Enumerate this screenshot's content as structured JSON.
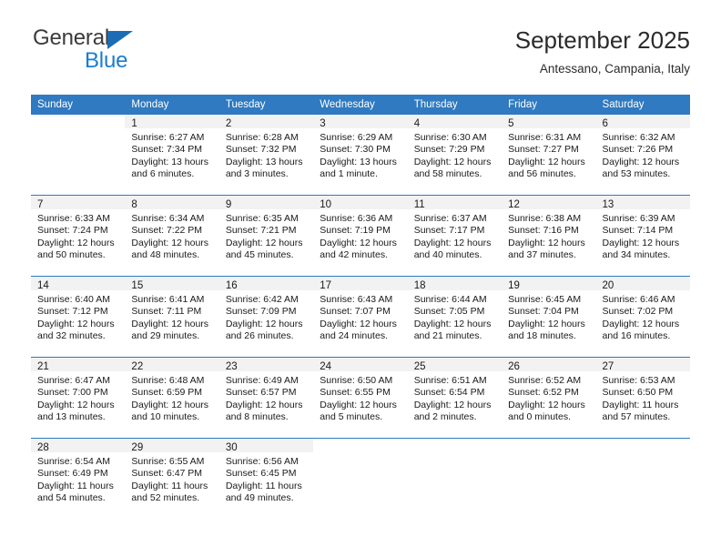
{
  "brand": {
    "name_part1": "General",
    "name_part2": "Blue",
    "triangle_color": "#1b6cb5",
    "blue_color": "#1b7cd1"
  },
  "header": {
    "title": "September 2025",
    "subtitle": "Antessano, Campania, Italy"
  },
  "theme": {
    "header_blue": "#2f7ac0",
    "day_band_gray": "#f2f2f2",
    "text_color": "#1a1a1a"
  },
  "weekday_headers": [
    "Sunday",
    "Monday",
    "Tuesday",
    "Wednesday",
    "Thursday",
    "Friday",
    "Saturday"
  ],
  "weeks": [
    [
      {
        "day": "",
        "sunrise": "",
        "sunset": "",
        "daylight1": "",
        "daylight2": ""
      },
      {
        "day": "1",
        "sunrise": "Sunrise: 6:27 AM",
        "sunset": "Sunset: 7:34 PM",
        "daylight1": "Daylight: 13 hours",
        "daylight2": "and 6 minutes."
      },
      {
        "day": "2",
        "sunrise": "Sunrise: 6:28 AM",
        "sunset": "Sunset: 7:32 PM",
        "daylight1": "Daylight: 13 hours",
        "daylight2": "and 3 minutes."
      },
      {
        "day": "3",
        "sunrise": "Sunrise: 6:29 AM",
        "sunset": "Sunset: 7:30 PM",
        "daylight1": "Daylight: 13 hours",
        "daylight2": "and 1 minute."
      },
      {
        "day": "4",
        "sunrise": "Sunrise: 6:30 AM",
        "sunset": "Sunset: 7:29 PM",
        "daylight1": "Daylight: 12 hours",
        "daylight2": "and 58 minutes."
      },
      {
        "day": "5",
        "sunrise": "Sunrise: 6:31 AM",
        "sunset": "Sunset: 7:27 PM",
        "daylight1": "Daylight: 12 hours",
        "daylight2": "and 56 minutes."
      },
      {
        "day": "6",
        "sunrise": "Sunrise: 6:32 AM",
        "sunset": "Sunset: 7:26 PM",
        "daylight1": "Daylight: 12 hours",
        "daylight2": "and 53 minutes."
      }
    ],
    [
      {
        "day": "7",
        "sunrise": "Sunrise: 6:33 AM",
        "sunset": "Sunset: 7:24 PM",
        "daylight1": "Daylight: 12 hours",
        "daylight2": "and 50 minutes."
      },
      {
        "day": "8",
        "sunrise": "Sunrise: 6:34 AM",
        "sunset": "Sunset: 7:22 PM",
        "daylight1": "Daylight: 12 hours",
        "daylight2": "and 48 minutes."
      },
      {
        "day": "9",
        "sunrise": "Sunrise: 6:35 AM",
        "sunset": "Sunset: 7:21 PM",
        "daylight1": "Daylight: 12 hours",
        "daylight2": "and 45 minutes."
      },
      {
        "day": "10",
        "sunrise": "Sunrise: 6:36 AM",
        "sunset": "Sunset: 7:19 PM",
        "daylight1": "Daylight: 12 hours",
        "daylight2": "and 42 minutes."
      },
      {
        "day": "11",
        "sunrise": "Sunrise: 6:37 AM",
        "sunset": "Sunset: 7:17 PM",
        "daylight1": "Daylight: 12 hours",
        "daylight2": "and 40 minutes."
      },
      {
        "day": "12",
        "sunrise": "Sunrise: 6:38 AM",
        "sunset": "Sunset: 7:16 PM",
        "daylight1": "Daylight: 12 hours",
        "daylight2": "and 37 minutes."
      },
      {
        "day": "13",
        "sunrise": "Sunrise: 6:39 AM",
        "sunset": "Sunset: 7:14 PM",
        "daylight1": "Daylight: 12 hours",
        "daylight2": "and 34 minutes."
      }
    ],
    [
      {
        "day": "14",
        "sunrise": "Sunrise: 6:40 AM",
        "sunset": "Sunset: 7:12 PM",
        "daylight1": "Daylight: 12 hours",
        "daylight2": "and 32 minutes."
      },
      {
        "day": "15",
        "sunrise": "Sunrise: 6:41 AM",
        "sunset": "Sunset: 7:11 PM",
        "daylight1": "Daylight: 12 hours",
        "daylight2": "and 29 minutes."
      },
      {
        "day": "16",
        "sunrise": "Sunrise: 6:42 AM",
        "sunset": "Sunset: 7:09 PM",
        "daylight1": "Daylight: 12 hours",
        "daylight2": "and 26 minutes."
      },
      {
        "day": "17",
        "sunrise": "Sunrise: 6:43 AM",
        "sunset": "Sunset: 7:07 PM",
        "daylight1": "Daylight: 12 hours",
        "daylight2": "and 24 minutes."
      },
      {
        "day": "18",
        "sunrise": "Sunrise: 6:44 AM",
        "sunset": "Sunset: 7:05 PM",
        "daylight1": "Daylight: 12 hours",
        "daylight2": "and 21 minutes."
      },
      {
        "day": "19",
        "sunrise": "Sunrise: 6:45 AM",
        "sunset": "Sunset: 7:04 PM",
        "daylight1": "Daylight: 12 hours",
        "daylight2": "and 18 minutes."
      },
      {
        "day": "20",
        "sunrise": "Sunrise: 6:46 AM",
        "sunset": "Sunset: 7:02 PM",
        "daylight1": "Daylight: 12 hours",
        "daylight2": "and 16 minutes."
      }
    ],
    [
      {
        "day": "21",
        "sunrise": "Sunrise: 6:47 AM",
        "sunset": "Sunset: 7:00 PM",
        "daylight1": "Daylight: 12 hours",
        "daylight2": "and 13 minutes."
      },
      {
        "day": "22",
        "sunrise": "Sunrise: 6:48 AM",
        "sunset": "Sunset: 6:59 PM",
        "daylight1": "Daylight: 12 hours",
        "daylight2": "and 10 minutes."
      },
      {
        "day": "23",
        "sunrise": "Sunrise: 6:49 AM",
        "sunset": "Sunset: 6:57 PM",
        "daylight1": "Daylight: 12 hours",
        "daylight2": "and 8 minutes."
      },
      {
        "day": "24",
        "sunrise": "Sunrise: 6:50 AM",
        "sunset": "Sunset: 6:55 PM",
        "daylight1": "Daylight: 12 hours",
        "daylight2": "and 5 minutes."
      },
      {
        "day": "25",
        "sunrise": "Sunrise: 6:51 AM",
        "sunset": "Sunset: 6:54 PM",
        "daylight1": "Daylight: 12 hours",
        "daylight2": "and 2 minutes."
      },
      {
        "day": "26",
        "sunrise": "Sunrise: 6:52 AM",
        "sunset": "Sunset: 6:52 PM",
        "daylight1": "Daylight: 12 hours",
        "daylight2": "and 0 minutes."
      },
      {
        "day": "27",
        "sunrise": "Sunrise: 6:53 AM",
        "sunset": "Sunset: 6:50 PM",
        "daylight1": "Daylight: 11 hours",
        "daylight2": "and 57 minutes."
      }
    ],
    [
      {
        "day": "28",
        "sunrise": "Sunrise: 6:54 AM",
        "sunset": "Sunset: 6:49 PM",
        "daylight1": "Daylight: 11 hours",
        "daylight2": "and 54 minutes."
      },
      {
        "day": "29",
        "sunrise": "Sunrise: 6:55 AM",
        "sunset": "Sunset: 6:47 PM",
        "daylight1": "Daylight: 11 hours",
        "daylight2": "and 52 minutes."
      },
      {
        "day": "30",
        "sunrise": "Sunrise: 6:56 AM",
        "sunset": "Sunset: 6:45 PM",
        "daylight1": "Daylight: 11 hours",
        "daylight2": "and 49 minutes."
      },
      {
        "day": "",
        "sunrise": "",
        "sunset": "",
        "daylight1": "",
        "daylight2": ""
      },
      {
        "day": "",
        "sunrise": "",
        "sunset": "",
        "daylight1": "",
        "daylight2": ""
      },
      {
        "day": "",
        "sunrise": "",
        "sunset": "",
        "daylight1": "",
        "daylight2": ""
      },
      {
        "day": "",
        "sunrise": "",
        "sunset": "",
        "daylight1": "",
        "daylight2": ""
      }
    ]
  ]
}
